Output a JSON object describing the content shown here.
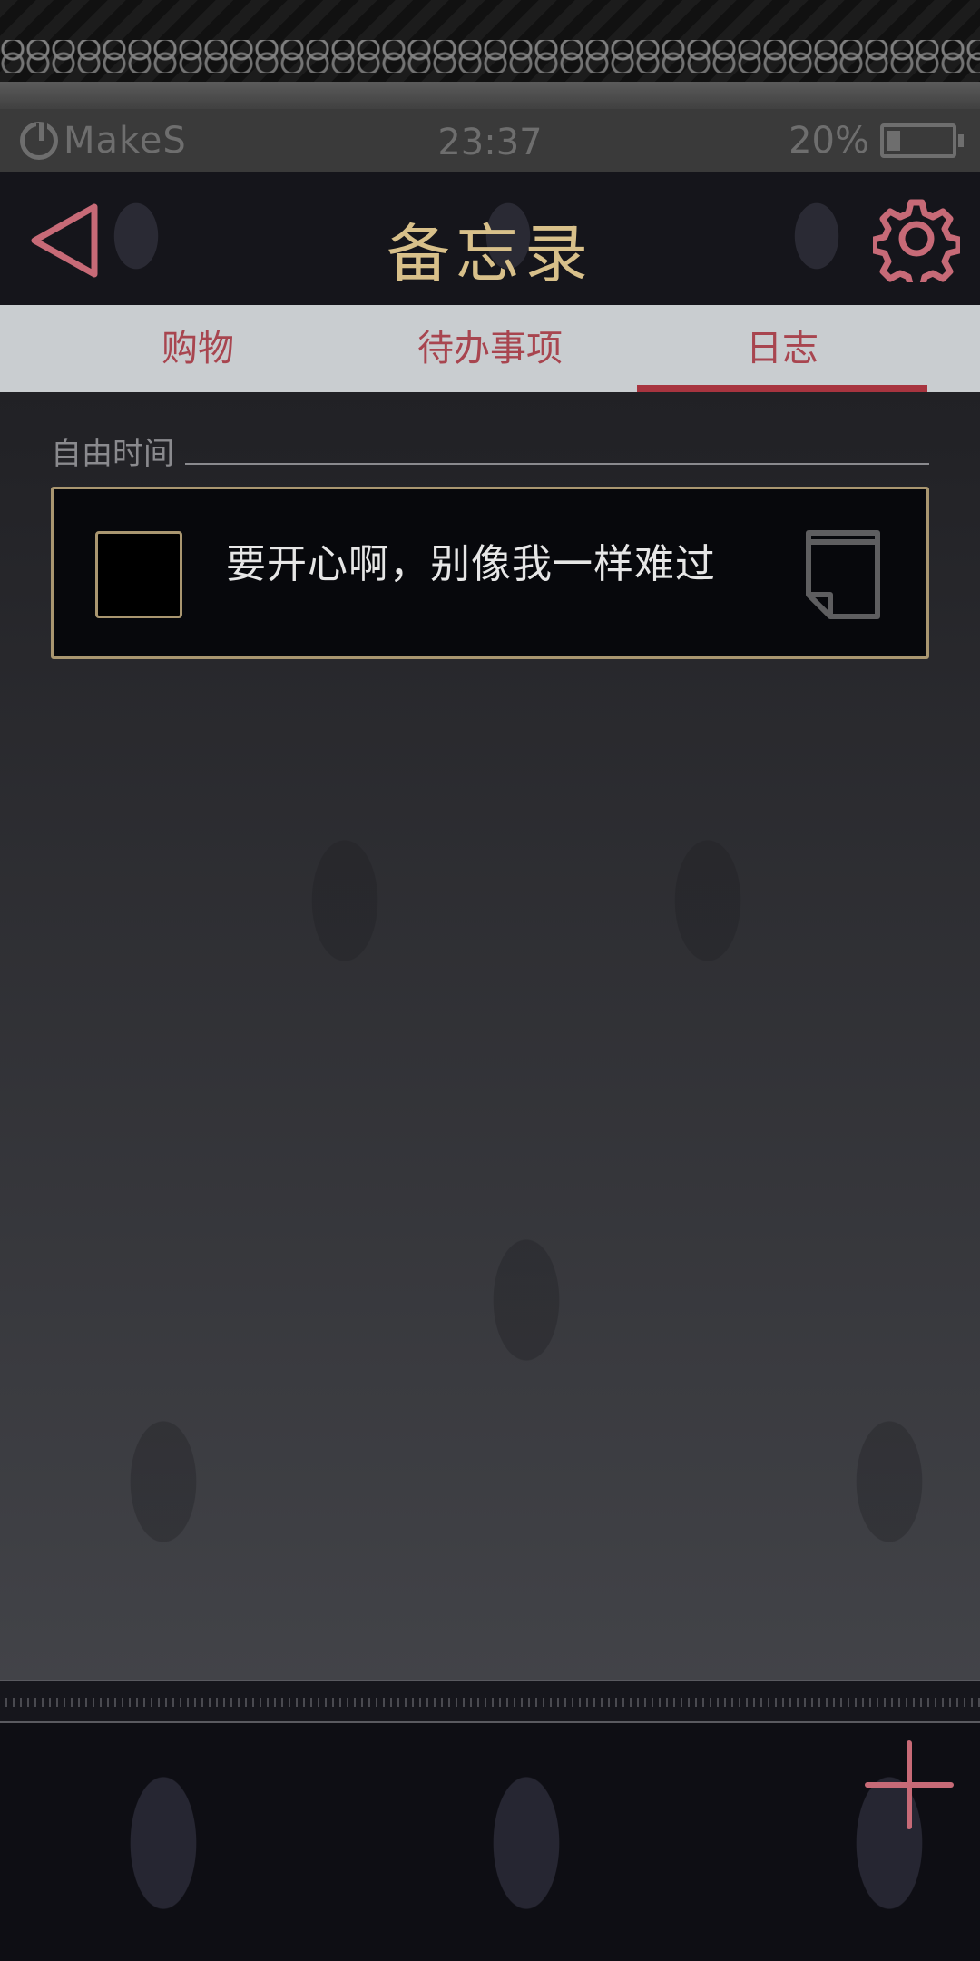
{
  "status_bar": {
    "carrier": "MakeS",
    "time": "23:37",
    "battery": "20%"
  },
  "header": {
    "title": "备忘录"
  },
  "tabs": [
    {
      "label": "购物",
      "active": false
    },
    {
      "label": "待办事项",
      "active": false
    },
    {
      "label": "日志",
      "active": true
    }
  ],
  "content": {
    "section_label": "自由时间",
    "notes": [
      {
        "text": "要开心啊，别像我一样难过",
        "checked": false
      }
    ]
  },
  "colors": {
    "accent_red": "#a7343f",
    "title_gold": "#d8c08a",
    "card_border": "#a99670"
  },
  "icons": {
    "back": "triangle-left-icon",
    "settings": "gear-icon",
    "note": "page-icon",
    "add": "plus-icon"
  }
}
